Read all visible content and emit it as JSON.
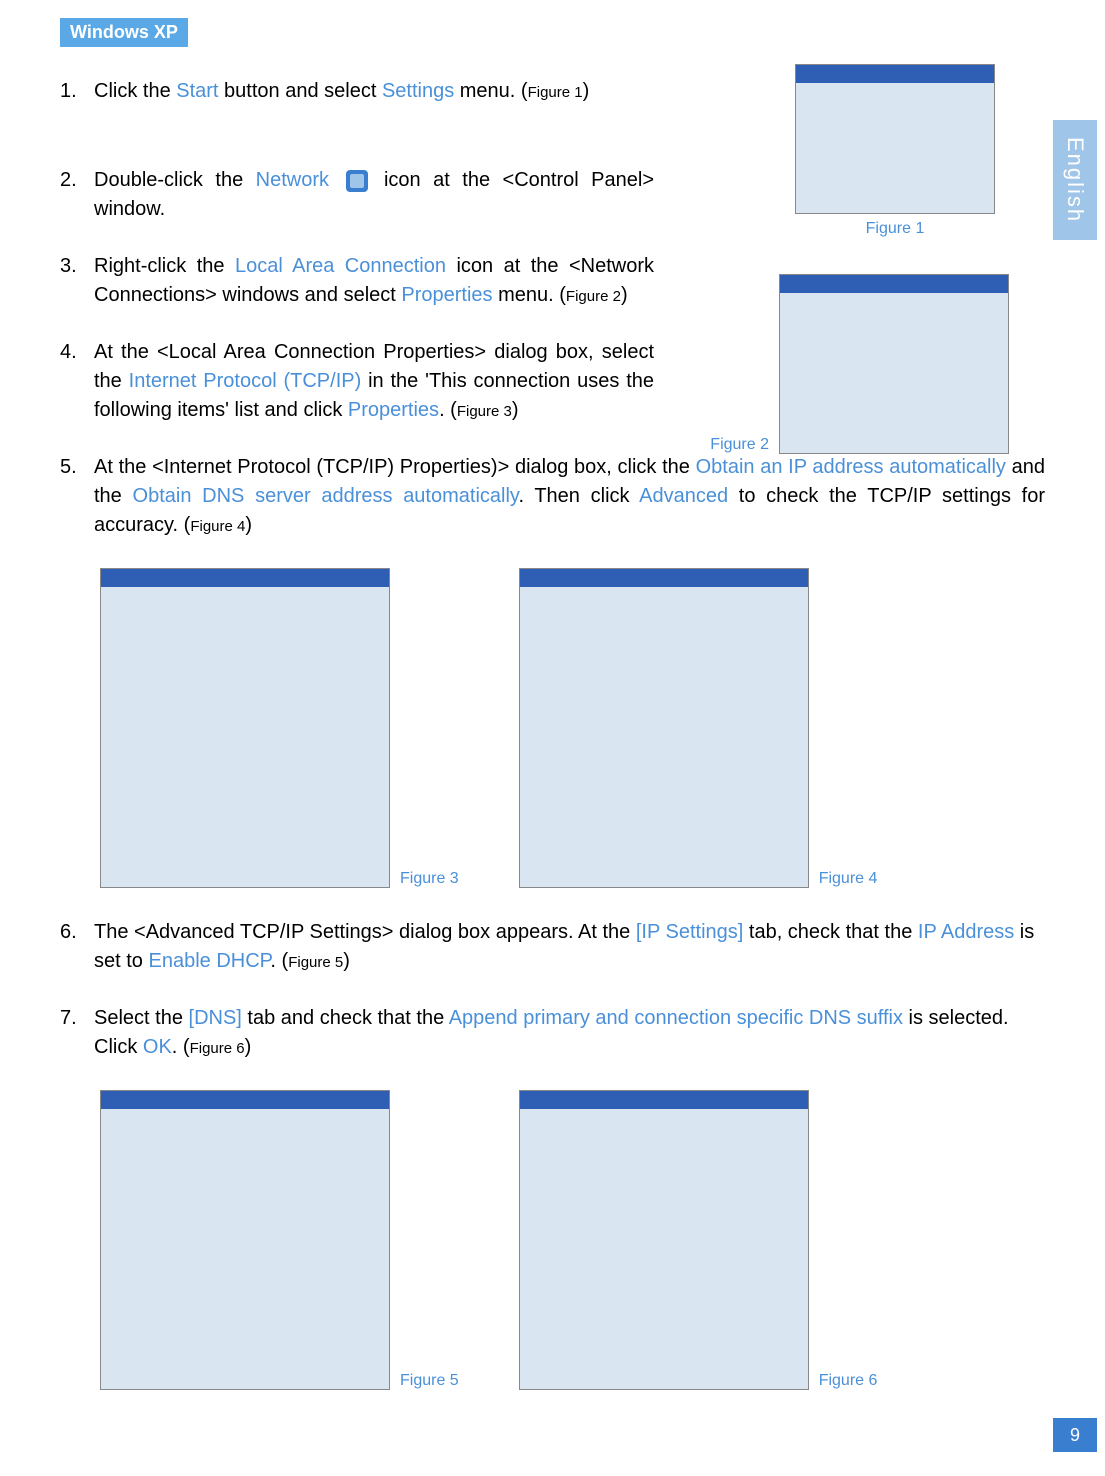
{
  "section_badge": "Windows XP",
  "side_tab": "English",
  "page_number": "9",
  "steps": {
    "s1": {
      "num": "1.",
      "pre": "Click the ",
      "hl1": "Start",
      "mid": " button and select ",
      "hl2": "Settings",
      "post": " menu. (",
      "figref": "Figure 1",
      "end": ")"
    },
    "s2": {
      "num": "2.",
      "pre": "Double-click the ",
      "hl1": "Network",
      "post": " icon at the <Control Panel> window."
    },
    "s3": {
      "num": "3.",
      "pre": "Right-click the ",
      "hl1": "Local Area Connection",
      "mid": " icon at the <Network Connections> windows and select ",
      "hl2": "Properties",
      "post": " menu. (",
      "figref": "Figure 2",
      "end": ")"
    },
    "s4": {
      "num": "4.",
      "pre": "At the <Local Area Connection Properties> dialog box, select the ",
      "hl1": "Internet Protocol (TCP/IP)",
      "mid": " in the 'This connection uses the following items' list and click ",
      "hl2": "Properties",
      "post": ". (",
      "figref": "Figure 3",
      "end": ")"
    },
    "s5": {
      "num": "5.",
      "pre": "At the <Internet Protocol (TCP/IP) Properties)> dialog box, click the ",
      "hl1": "Obtain an IP address automatically",
      "mid": " and the ",
      "hl2": "Obtain DNS server address automatically",
      "post1": ". Then click ",
      "hl3": "Advanced",
      "post2": " to check the TCP/IP settings for accuracy. (",
      "figref": "Figure 4",
      "end": ")"
    },
    "s6": {
      "num": "6.",
      "pre": "The <Advanced TCP/IP Settings> dialog box appears. At the ",
      "hl1": "[IP Settings]",
      "mid": " tab, check that the ",
      "hl2": "IP Address",
      "mid2": " is set to ",
      "hl3": "Enable DHCP",
      "post": ". (",
      "figref": "Figure 5",
      "end": ")"
    },
    "s7": {
      "num": "7.",
      "pre": "Select the ",
      "hl1": "[DNS]",
      "mid": " tab and check that the ",
      "hl2": "Append primary and connection specific DNS suffix",
      "mid2": " is selected. Click ",
      "hl3": "OK",
      "post": ". (",
      "figref": "Figure 6",
      "end": ")"
    }
  },
  "figures": {
    "f1": "Figure 1",
    "f2": "Figure 2",
    "f3": "Figure 3",
    "f4": "Figure 4",
    "f5": "Figure 5",
    "f6": "Figure 6"
  }
}
